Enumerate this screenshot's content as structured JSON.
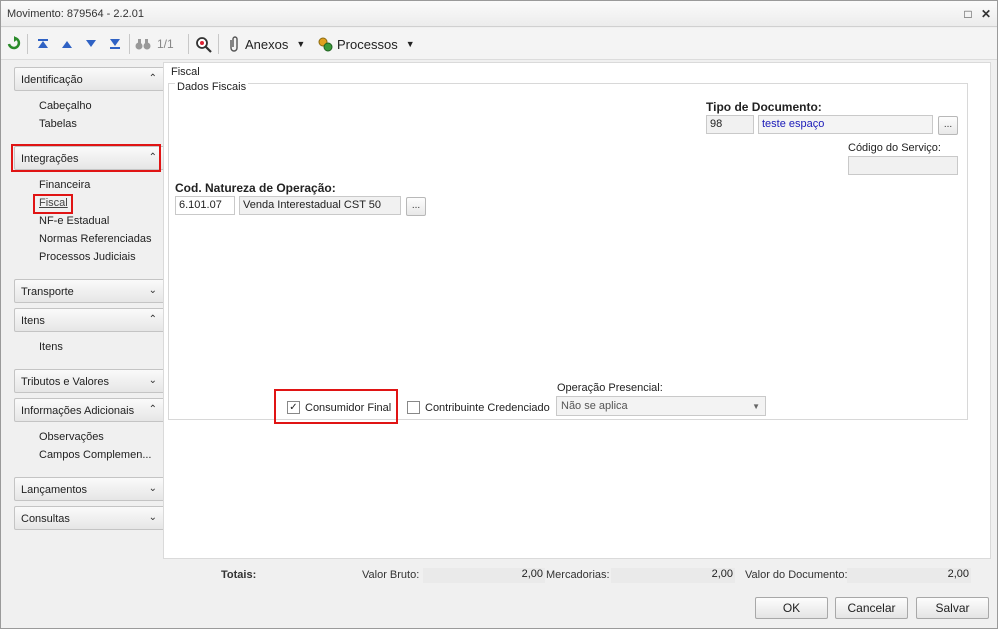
{
  "window": {
    "title": "Movimento: 879564 - 2.2.01"
  },
  "toolbar": {
    "refresh_icon": "refresh-icon",
    "record_counter": "1/1",
    "anexos_label": "Anexos",
    "processos_label": "Processos"
  },
  "sidebar": {
    "groups": [
      {
        "label": "Identificação",
        "items": [
          "Cabeçalho",
          "Tabelas"
        ]
      },
      {
        "label": "Integrações",
        "items": [
          "Financeira",
          "Fiscal",
          "NF-e Estadual",
          "Normas Referenciadas",
          "Processos Judiciais"
        ]
      },
      {
        "label": "Transporte",
        "items": []
      },
      {
        "label": "Itens",
        "items": [
          "Itens"
        ]
      },
      {
        "label": "Tributos e Valores",
        "items": []
      },
      {
        "label": "Informações Adicionais",
        "items": [
          "Observações",
          "Campos Complemen..."
        ]
      },
      {
        "label": "Lançamentos",
        "items": []
      },
      {
        "label": "Consultas",
        "items": []
      }
    ]
  },
  "fiscal": {
    "section_title": "Fiscal",
    "frame_title": "Dados Fiscais",
    "tipo_documento_label": "Tipo de Documento:",
    "tipo_documento_code": "98",
    "tipo_documento_desc": "teste espaço",
    "codigo_servico_label": "Código do Serviço:",
    "codigo_servico_value": "",
    "natureza_label": "Cod. Natureza de Operação:",
    "natureza_code": "6.101.07",
    "natureza_desc": "Venda Interestadual CST 50",
    "ellipsis": "...",
    "consumidor_final_label": "Consumidor Final",
    "consumidor_final_checked": true,
    "contribuinte_label": "Contribuinte Credenciado",
    "contribuinte_checked": false,
    "operacao_presencial_label": "Operação Presencial:",
    "operacao_presencial_value": "Não se aplica"
  },
  "totals": {
    "label": "Totais:",
    "valor_bruto_label": "Valor Bruto:",
    "valor_bruto": "2,00",
    "mercadorias_label": "Mercadorias:",
    "mercadorias": "2,00",
    "valor_documento_label": "Valor do Documento:",
    "valor_documento": "2,00"
  },
  "buttons": {
    "ok": "OK",
    "cancel": "Cancelar",
    "save": "Salvar"
  }
}
